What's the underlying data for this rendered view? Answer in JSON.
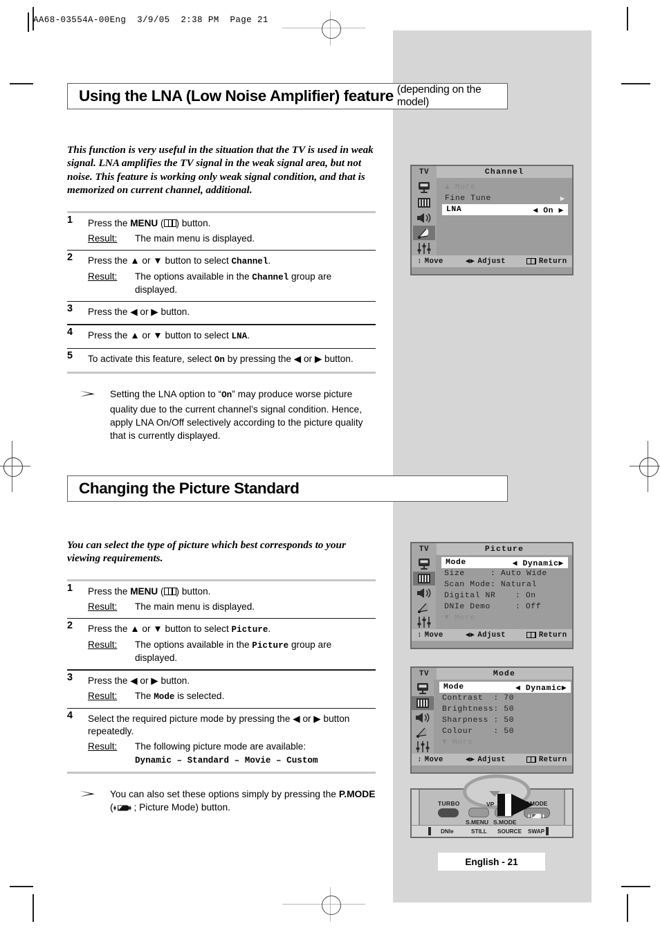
{
  "page": {
    "slug": "AA68-03554A-00Eng  3/9/05  2:38 PM  Page 21",
    "footer": "English - 21"
  },
  "section1": {
    "title": "Using the LNA (Low Noise Amplifier) feature",
    "title_suffix": "(depending on the model)",
    "intro": "This function is very useful in the situation that the TV is used in weak signal. LNA amplifies the TV signal in the weak signal area, but not noise. This feature is working only weak signal condition, and that is memorized on current channel, additional.",
    "steps": [
      {
        "num": "1",
        "pre": "Press the ",
        "bold": "MENU",
        "post": ") button.",
        "icon": "menu-icon",
        "result_label": "Result:",
        "result_text": "The main menu is displayed."
      },
      {
        "num": "2",
        "pre": "Press the ▲ or ▼ button to select ",
        "mono": "Channel",
        "post": ".",
        "result_label": "Result:",
        "result_pre": "The options available in the ",
        "result_mono": "Channel",
        "result_post": " group are displayed."
      },
      {
        "num": "3",
        "pre": "Press the ◀ or ▶ button.",
        "mono": "",
        "post": ""
      },
      {
        "num": "4",
        "pre": "Press the ▲ or ▼ button to select ",
        "mono": "LNA",
        "post": "."
      },
      {
        "num": "5",
        "pre": "To activate this feature, select ",
        "mono": "On",
        "post": " by pressing the ◀ or ▶ button."
      }
    ],
    "note": {
      "arrow": "➤",
      "pre": "Setting the LNA option to “",
      "bold": "On",
      "post": "” may produce worse picture quality due to the current channel’s signal condition. Hence, apply LNA On/Off selectively according to the picture quality that is currently displayed."
    }
  },
  "section2": {
    "title": "Changing the Picture Standard",
    "intro": "You can select the type of picture which best corresponds to your viewing requirements.",
    "steps": [
      {
        "num": "1",
        "pre": "Press the ",
        "bold": "MENU",
        "post": ") button.",
        "icon": "menu-icon",
        "result_label": "Result:",
        "result_text": "The main menu is displayed."
      },
      {
        "num": "2",
        "pre": "Press the ▲ or ▼ button to select ",
        "mono": "Picture",
        "post": ".",
        "result_label": "Result:",
        "result_pre": "The options available in the ",
        "result_mono": "Picture",
        "result_post": " group are displayed."
      },
      {
        "num": "3",
        "pre": "Press the ◀ or ▶ button.",
        "result_label": "Result:",
        "result_pre": "The ",
        "result_mono": "Mode",
        "result_post": " is selected."
      },
      {
        "num": "4",
        "pre": "Select the required picture mode by pressing the ◀ or ▶ button repeatedly.",
        "result_label": "Result:",
        "result_text": "The following picture mode are available:",
        "result_mono_line": "Dynamic – Standard – Movie – Custom"
      }
    ],
    "note": {
      "arrow": "➤",
      "pre": "You can also set these options simply by pressing the ",
      "bold": "P.MODE",
      "mid": " (",
      "icon": "pmode-icon",
      "post": " ; Picture Mode) button."
    }
  },
  "osd_channel": {
    "tv_label": "TV",
    "title": "Channel",
    "rail_icons": [
      "tv-tuner-icon",
      "picture-icon",
      "sound-icon",
      "satellite-icon",
      "setup-icon"
    ],
    "selected_rail": 3,
    "rows": [
      {
        "label": "▲ More",
        "value": "",
        "style": "dim"
      },
      {
        "label": "Fine Tune",
        "value": "▶",
        "style": "normal"
      },
      {
        "label": "LNA",
        "value": "◀ On ▶",
        "style": "highlight"
      }
    ],
    "footer": {
      "move": "Move",
      "adjust": "Adjust",
      "return": "Return"
    }
  },
  "osd_picture": {
    "tv_label": "TV",
    "title": "Picture",
    "rail_icons": [
      "tv-tuner-icon",
      "picture-icon",
      "sound-icon",
      "satellite-icon",
      "setup-icon"
    ],
    "selected_rail": 1,
    "rows": [
      {
        "label": "Mode",
        "value": "◀ Dynamic",
        "arrow": "▶",
        "style": "highlight"
      },
      {
        "label": "Size",
        "value": ":  Auto Wide",
        "style": "normal"
      },
      {
        "label": "Scan Mode",
        "value": ":  Natural",
        "style": "normal"
      },
      {
        "label": "Digital NR",
        "value": ":  On",
        "style": "normal"
      },
      {
        "label": "DNIe Demo",
        "value": ":  Off",
        "style": "normal"
      },
      {
        "label": "▼ More",
        "value": "",
        "style": "dim"
      }
    ],
    "footer": {
      "move": "Move",
      "adjust": "Adjust",
      "return": "Return"
    }
  },
  "osd_mode": {
    "tv_label": "TV",
    "title": "Mode",
    "rail_icons": [
      "tv-tuner-icon",
      "picture-icon",
      "sound-icon",
      "satellite-icon",
      "setup-icon"
    ],
    "selected_rail": 1,
    "rows": [
      {
        "label": "Mode",
        "value": "◀ Dynamic",
        "arrow": "▶",
        "style": "highlight"
      },
      {
        "label": "Contrast",
        "value": ":  70",
        "style": "normal"
      },
      {
        "label": "Brightness",
        "value": ":  50",
        "style": "normal"
      },
      {
        "label": "Sharpness",
        "value": ":  50",
        "style": "normal"
      },
      {
        "label": "Colour",
        "value": ":  50",
        "style": "normal"
      },
      {
        "label": "▼ More",
        "value": "",
        "style": "dim"
      }
    ],
    "footer": {
      "move": "Move",
      "adjust": "Adjust",
      "return": "Return"
    }
  },
  "remote": {
    "buttons_top": [
      "TURBO",
      "S.MENU",
      "S.MODE",
      "P.MODE"
    ],
    "label_vp": "VP",
    "buttons_bottom": [
      "DNIe",
      "STILL",
      "SOURCE",
      "SWAP"
    ]
  }
}
